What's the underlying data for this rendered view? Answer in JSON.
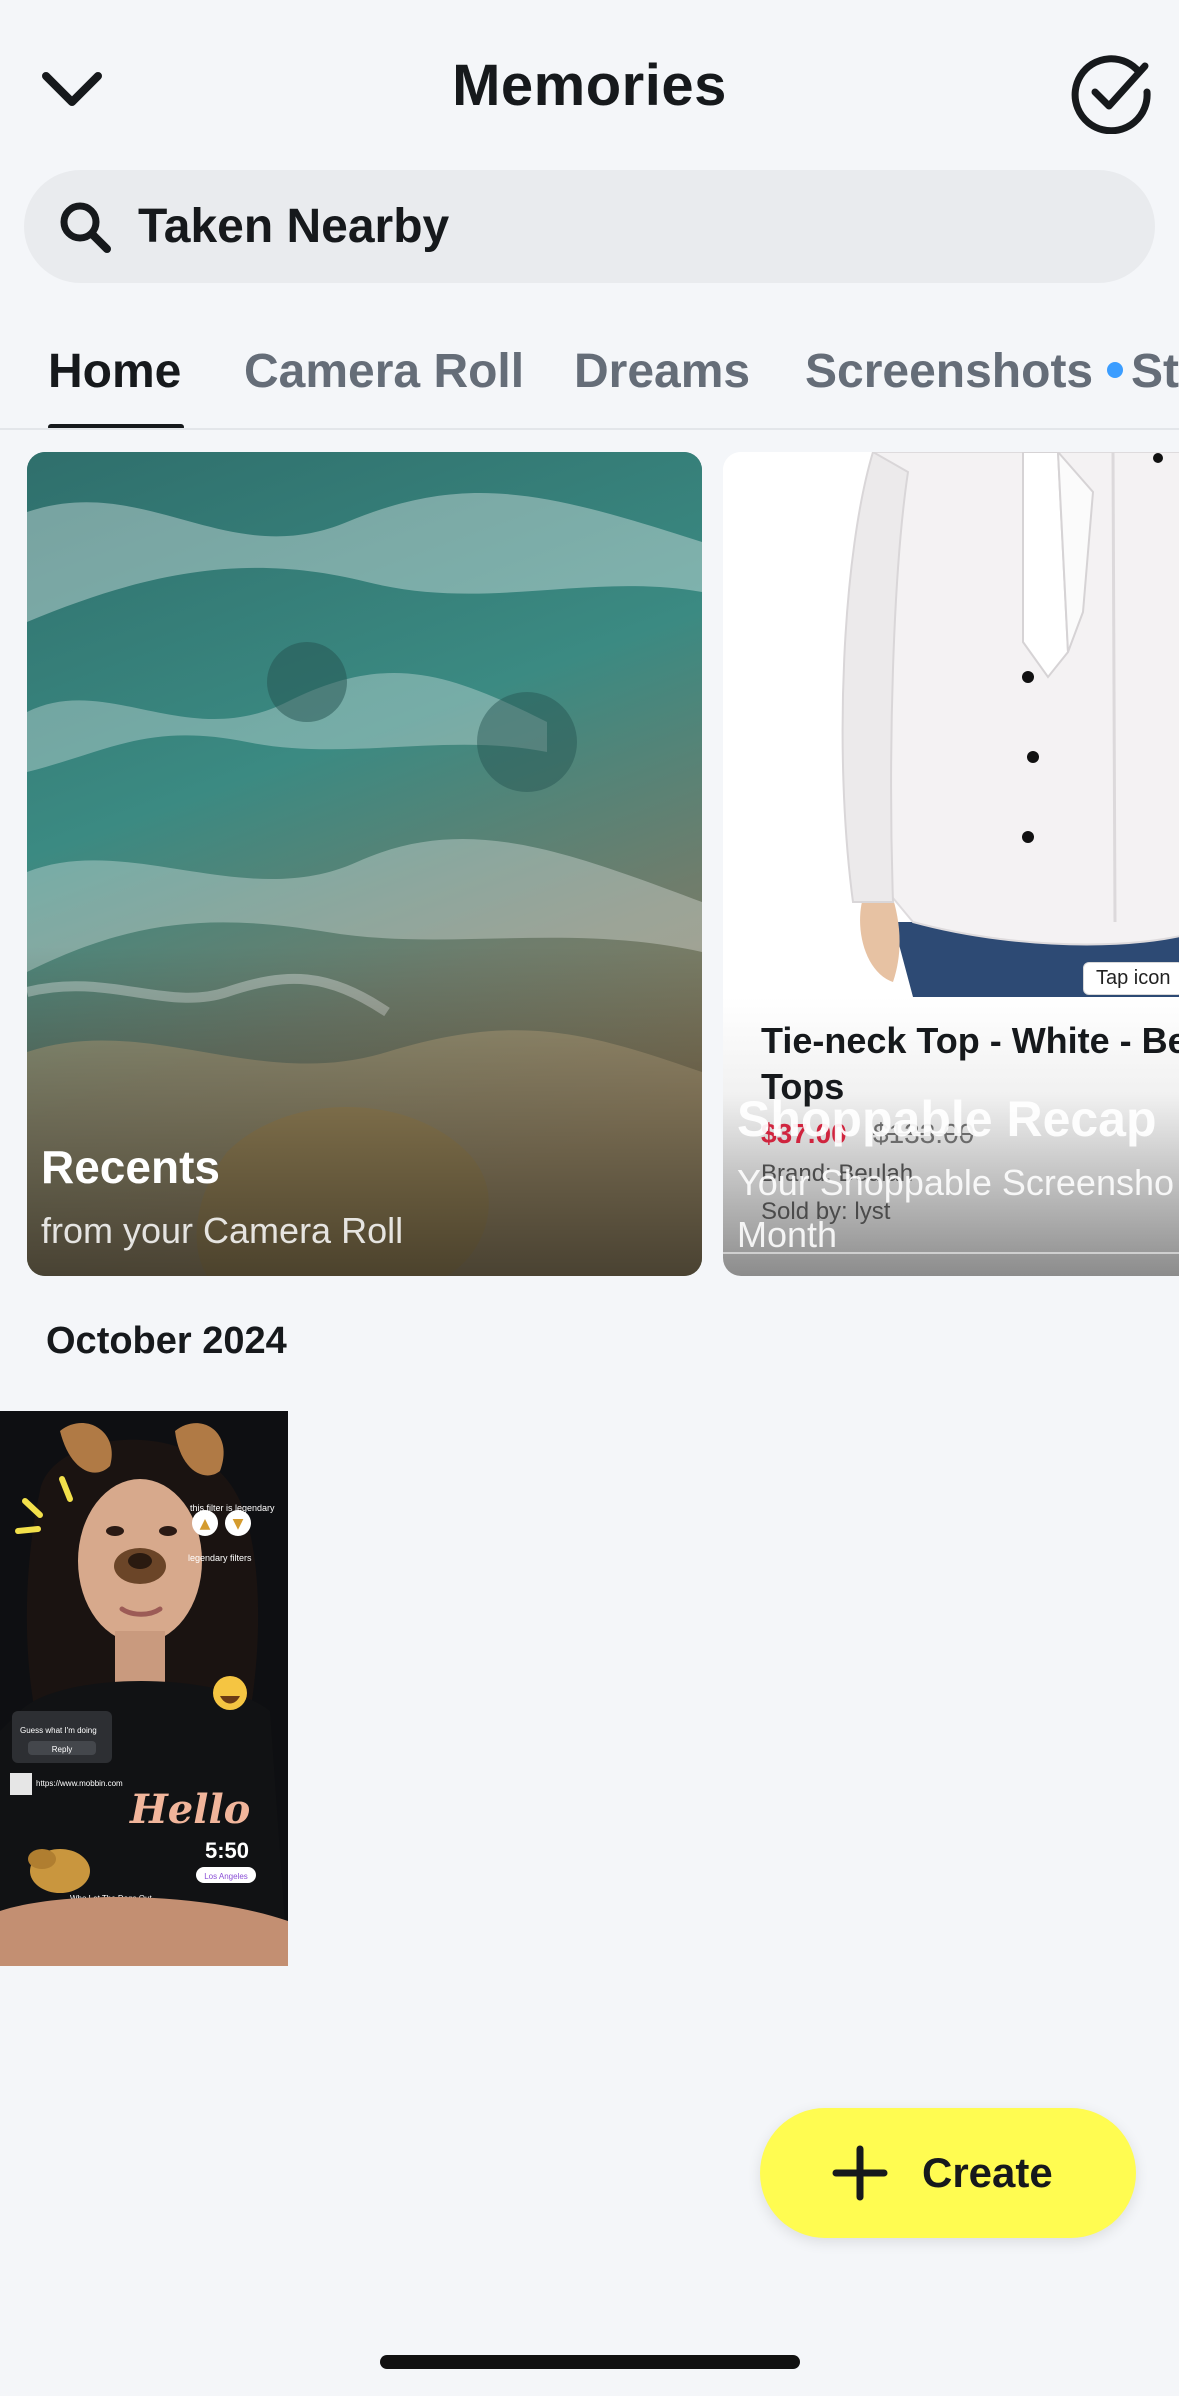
{
  "header": {
    "title": "Memories"
  },
  "search": {
    "text": "Taken Nearby"
  },
  "tabs": [
    {
      "label": "Home",
      "active": true
    },
    {
      "label": "Camera Roll",
      "active": false
    },
    {
      "label": "Dreams",
      "active": false
    },
    {
      "label": "Screenshots",
      "active": false,
      "has_dot": true
    },
    {
      "label": "St",
      "active": false
    }
  ],
  "cards": {
    "recents": {
      "title": "Recents",
      "subtitle": "from your Camera Roll"
    },
    "recap": {
      "product_name": "Tie-neck Top - White - Beul Tops",
      "price_now": "$37.00",
      "price_old": "$133.00",
      "brand": "Brand: Beulah",
      "sold_by": "Sold by: lyst",
      "tap_badge": "Tap icon",
      "title": "Shoppable Recap",
      "subtitle": "Your Shoppable Screensho",
      "month": "Month"
    }
  },
  "section": {
    "title": "October 2024"
  },
  "snap_thumb": {
    "sticker_text_1": "this filter is legendary",
    "sticker_text_2": "legendary filters",
    "poll_text": "Guess what I'm doing",
    "poll_reply": "Reply",
    "link_text": "https://www.mobbin.com",
    "hello_text": "Hello",
    "time_text": "5:50",
    "location_text": "Los Angeles",
    "music_text": "Who Let The Dogs Out"
  },
  "fab": {
    "label": "Create"
  },
  "colors": {
    "accent_yellow": "#fffc51",
    "tab_dot_blue": "#3b9dff",
    "price_red": "#d0243e",
    "background": "#f4f6f9"
  }
}
